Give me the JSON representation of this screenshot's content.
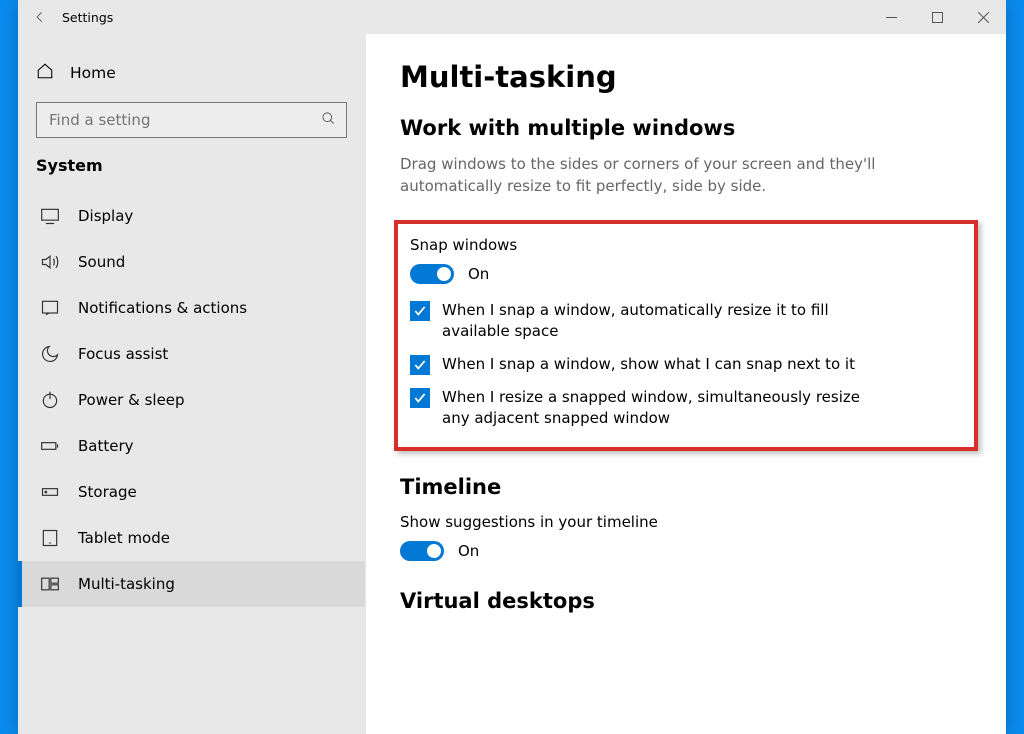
{
  "window": {
    "title": "Settings"
  },
  "sidebar": {
    "home": "Home",
    "search_placeholder": "Find a setting",
    "category": "System",
    "items": [
      {
        "label": "Display"
      },
      {
        "label": "Sound"
      },
      {
        "label": "Notifications & actions"
      },
      {
        "label": "Focus assist"
      },
      {
        "label": "Power & sleep"
      },
      {
        "label": "Battery"
      },
      {
        "label": "Storage"
      },
      {
        "label": "Tablet mode"
      },
      {
        "label": "Multi-tasking"
      }
    ],
    "active_index": 8
  },
  "content": {
    "page_title": "Multi-tasking",
    "section1": {
      "heading": "Work with multiple windows",
      "desc": "Drag windows to the sides or corners of your screen and they'll automatically resize to fit perfectly, side by side.",
      "snap_label": "Snap windows",
      "snap_state": "On",
      "checks": [
        "When I snap a window, automatically resize it to fill available space",
        "When I snap a window, show what I can snap next to it",
        "When I resize a snapped window, simultaneously resize any adjacent snapped window"
      ]
    },
    "section2": {
      "heading": "Timeline",
      "label": "Show suggestions in your timeline",
      "state": "On"
    },
    "section3": {
      "heading": "Virtual desktops"
    }
  }
}
